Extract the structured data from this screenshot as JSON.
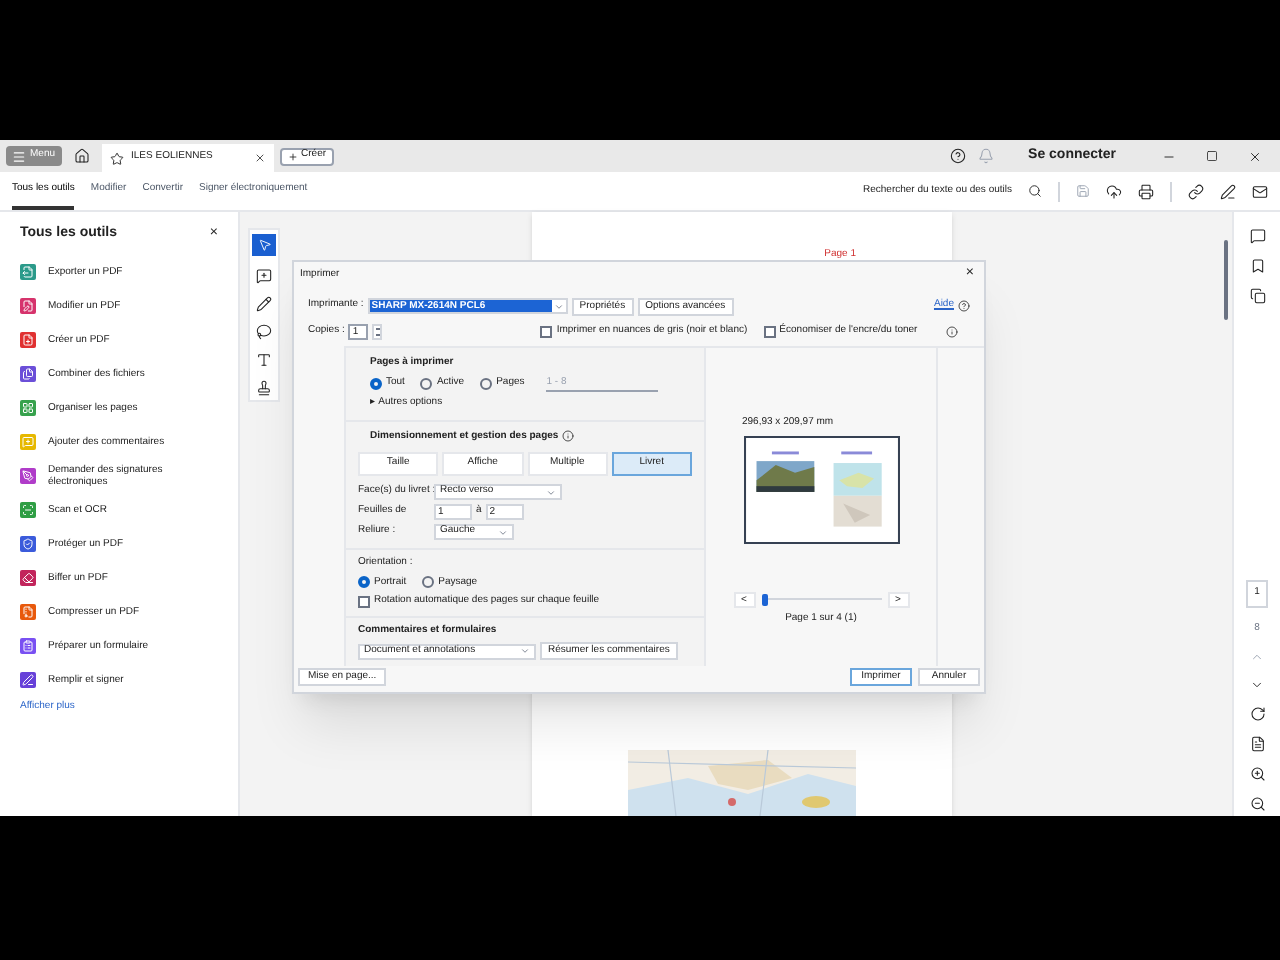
{
  "title_bar": {
    "menu": "Menu",
    "tab_title": "ILES EOLIENNES",
    "create": "Créer",
    "sign_in": "Se connecter"
  },
  "toolbar": {
    "tabs": [
      {
        "label": "Tous les outils",
        "selected": true
      },
      {
        "label": "Modifier",
        "selected": false
      },
      {
        "label": "Convertir",
        "selected": false
      },
      {
        "label": "Signer électroniquement",
        "selected": false
      }
    ],
    "search": "Rechercher du texte ou des outils"
  },
  "tools_panel": {
    "title": "Tous les outils",
    "close": "×",
    "items": [
      {
        "label": "Exporter un PDF",
        "color": "#2b9a8a"
      },
      {
        "label": "Modifier un PDF",
        "color": "#d6336c"
      },
      {
        "label": "Créer un PDF",
        "color": "#e03131"
      },
      {
        "label": "Combiner des fichiers",
        "color": "#6b4fd8"
      },
      {
        "label": "Organiser les pages",
        "color": "#37a24d"
      },
      {
        "label": "Ajouter des commentaires",
        "color": "#e6b800"
      },
      {
        "label": "Demander des signatures électroniques",
        "color": "#b03cc9"
      },
      {
        "label": "Scan et OCR",
        "color": "#2f9e44"
      },
      {
        "label": "Protéger un PDF",
        "color": "#3b5bdb"
      },
      {
        "label": "Biffer un PDF",
        "color": "#c2255c"
      },
      {
        "label": "Compresser un PDF",
        "color": "#e8590c"
      },
      {
        "label": "Préparer un formulaire",
        "color": "#7950f2"
      },
      {
        "label": "Remplir et signer",
        "color": "#6741d9"
      }
    ],
    "more": "Afficher plus"
  },
  "document": {
    "page_label": "Page 1",
    "kind": "picture"
  },
  "page_nav": {
    "current": "1",
    "total": "8"
  },
  "print_dialog": {
    "title": "Imprimer",
    "close": "×",
    "printer_label": "Imprimante :",
    "printer": "SHARP MX-2614N PCL6",
    "properties": "Propriétés",
    "advanced": "Options avancées",
    "help": "Aide",
    "copies_label": "Copies :",
    "copies": "1",
    "checks": [
      {
        "label": "Imprimer en nuances de gris (noir et blanc)",
        "checked": false
      },
      {
        "label": "Économiser de l'encre/du toner",
        "checked": false
      }
    ],
    "pages_title": "Pages à imprimer",
    "pages_options": [
      {
        "label": "Tout",
        "selected": true
      },
      {
        "label": "Active",
        "selected": false
      },
      {
        "label": "Pages",
        "selected": false
      }
    ],
    "pages_range": "1 - 8",
    "more_options": "▸ Autres options",
    "sizing_title": "Dimensionnement et gestion des pages",
    "sizing_modes": [
      {
        "label": "Taille",
        "selected": false
      },
      {
        "label": "Affiche",
        "selected": false
      },
      {
        "label": "Multiple",
        "selected": false
      },
      {
        "label": "Livret",
        "selected": true
      }
    ],
    "booklet_label": "Face(s) du livret :",
    "booklet": "Recto verso",
    "sheets_label": "Feuilles de",
    "sheets_from": "1",
    "sheets_to_label": "à",
    "sheets_to": "2",
    "binding_label": "Reliure :",
    "binding": "Gauche",
    "orientation_title": "Orientation :",
    "orientations": [
      {
        "label": "Portrait",
        "selected": true
      },
      {
        "label": "Paysage",
        "selected": false
      }
    ],
    "auto_rotate": {
      "label": "Rotation automatique des pages sur chaque feuille",
      "checked": false
    },
    "comments_title": "Commentaires et formulaires",
    "comments": "Document et annotations",
    "summarize": "Résumer les commentaires",
    "paper_size": "296,93 x 209,97 mm",
    "prev": "<",
    "next": ">",
    "preview_slider": {
      "level": 0
    },
    "page_info": "Page 1 sur 4 (1)",
    "page_setup": "Mise en page...",
    "print": "Imprimer",
    "cancel": "Annuler"
  }
}
